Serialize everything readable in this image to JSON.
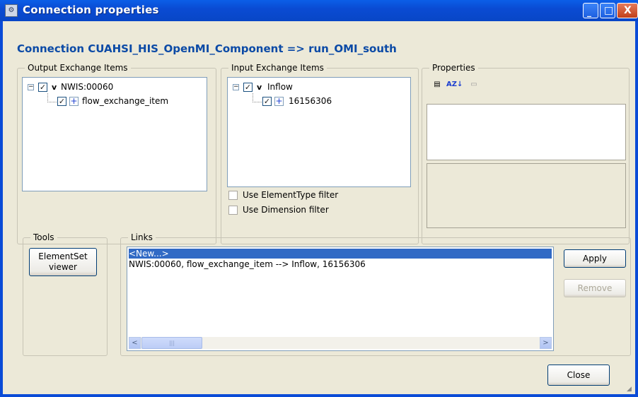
{
  "window": {
    "title": "Connection properties",
    "minimize_glyph": "_",
    "maximize_glyph": "□",
    "close_glyph": "X"
  },
  "header": {
    "text": "Connection CUAHSI_HIS_OpenMI_Component => run_OMI_south"
  },
  "output_items": {
    "legend": "Output Exchange Items",
    "root": {
      "expander": "−",
      "checked": true,
      "label": "NWIS:00060"
    },
    "child": {
      "checked": true,
      "label": "flow_exchange_item"
    }
  },
  "input_items": {
    "legend": "Input Exchange Items",
    "root": {
      "expander": "−",
      "checked": true,
      "label": "Inflow"
    },
    "child": {
      "checked": true,
      "label": "16156306"
    },
    "filters": [
      {
        "label": "Use ElementType filter",
        "checked": false
      },
      {
        "label": "Use Dimension filter",
        "checked": false
      }
    ]
  },
  "properties": {
    "legend": "Properties",
    "toolbar": [
      "categorized-icon",
      "alphabetical-sort-icon",
      "property-pages-icon"
    ]
  },
  "tools": {
    "legend": "Tools",
    "elementset_button": "ElementSet viewer"
  },
  "links": {
    "legend": "Links",
    "items": [
      {
        "text": "<New...>",
        "selected": true
      },
      {
        "text": "NWIS:00060, flow_exchange_item --> Inflow, 16156306",
        "selected": false
      }
    ],
    "apply_button": "Apply",
    "remove_button": "Remove",
    "scroll_left": "<",
    "scroll_right": ">"
  },
  "footer": {
    "close_button": "Close"
  },
  "glyphs": {
    "check": "✓",
    "plus": "+",
    "v": "v",
    "thumb_grip": "|||"
  },
  "colors": {
    "title_blue": "#0a4bd3",
    "header_text": "#0b4aa6",
    "selection": "#316ac5",
    "dialog_bg": "#ece9d8"
  }
}
